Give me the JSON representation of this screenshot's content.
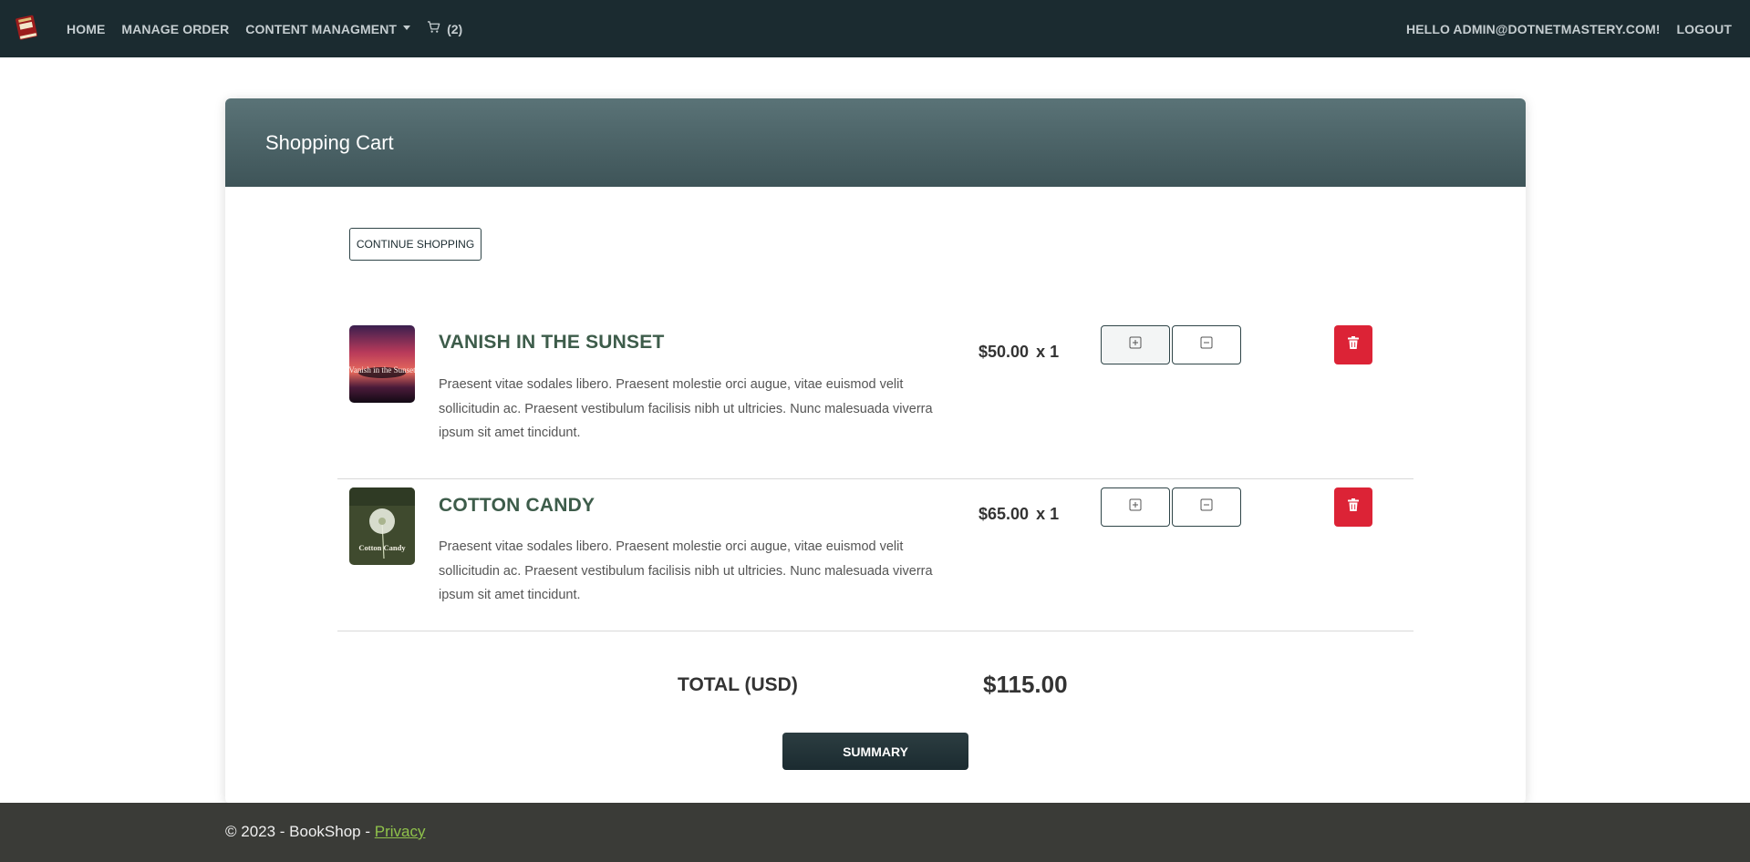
{
  "nav": {
    "home": "HOME",
    "manage_order": "MANAGE ORDER",
    "content_management": "CONTENT MANAGMENT",
    "cart_count": "(2)",
    "greeting": "HELLO ADMIN@DOTNETMASTERY.COM!",
    "logout": "LOGOUT"
  },
  "card": {
    "title": "Shopping Cart",
    "continue_label": "CONTINUE SHOPPING"
  },
  "items": [
    {
      "title": "VANISH IN THE SUNSET",
      "description": "Praesent vitae sodales libero. Praesent molestie orci augue, vitae euismod velit sollicitudin ac. Praesent vestibulum facilisis nibh ut ultricies. Nunc malesuada viverra ipsum sit amet tincidunt.",
      "price": "$50.00",
      "quantity": "x 1",
      "cover_text": "Vanish in the Sunset"
    },
    {
      "title": "COTTON CANDY",
      "description": "Praesent vitae sodales libero. Praesent molestie orci augue, vitae euismod velit sollicitudin ac. Praesent vestibulum facilisis nibh ut ultricies. Nunc malesuada viverra ipsum sit amet tincidunt.",
      "price": "$65.00",
      "quantity": "x 1",
      "cover_text": "Cotton Candy"
    }
  ],
  "total": {
    "label": "TOTAL (USD)",
    "value": "$115.00"
  },
  "summary_label": "SUMMARY",
  "footer": {
    "text": "© 2023 - BookShop - ",
    "privacy": "Privacy"
  },
  "colors": {
    "navbar": "#1b2b30",
    "accent_header": "#4a6266",
    "title_green": "#3d5c4a",
    "delete_red": "#dc2336",
    "footer_bg": "#3a3b37",
    "footer_link": "#8fc24b"
  }
}
